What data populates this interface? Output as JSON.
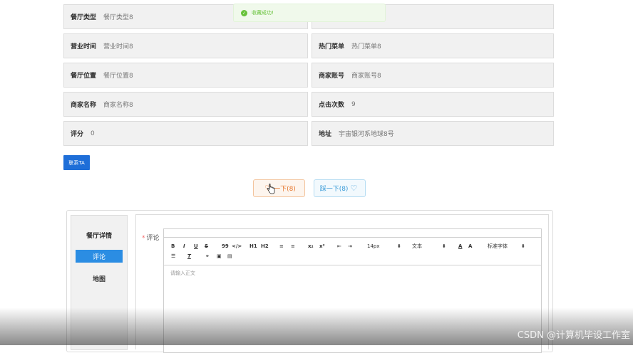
{
  "fields": [
    {
      "label": "餐厅类型",
      "value": "餐厅类型8"
    },
    {
      "label": "",
      "value": ""
    },
    {
      "label": "营业时间",
      "value": "营业时间8"
    },
    {
      "label": "热门菜单",
      "value": "热门菜单8"
    },
    {
      "label": "餐厅位置",
      "value": "餐厅位置8"
    },
    {
      "label": "商家账号",
      "value": "商家账号8"
    },
    {
      "label": "商家名称",
      "value": "商家名称8"
    },
    {
      "label": "点击次数",
      "value": "9"
    },
    {
      "label": "评分",
      "value": "0"
    },
    {
      "label": "地址",
      "value": "宇宙银河系地球8号"
    }
  ],
  "toast": {
    "message": "收藏成功!",
    "icon": "check-circle-icon",
    "color": "#67c23a"
  },
  "contact_button": "联系TA",
  "actions": {
    "favorite_label": "一下(8)",
    "dislike_label": "踩一下(8)"
  },
  "sidebar": {
    "items": [
      {
        "label": "餐厅详情",
        "active": false
      },
      {
        "label": "评论",
        "active": true
      },
      {
        "label": "地图",
        "active": false
      }
    ]
  },
  "comment_form": {
    "required_mark": "*",
    "label": "评论",
    "toolbar_row1": [
      "B",
      "I",
      "U",
      "S",
      "99",
      "</>",
      "H1",
      "H2",
      "≡",
      "≡",
      "x₂",
      "x²",
      "⇤",
      "⇥",
      "14px",
      "文本",
      "A",
      "A",
      "标准字体"
    ],
    "font_size": "14px",
    "text_style": "文本",
    "font_family": "标准字体",
    "placeholder": "请输入正文"
  },
  "watermark": "CSDN @计算机毕设工作室",
  "colors": {
    "primary_button": "#1e6ed8",
    "active_tab": "#2b8de3",
    "favorite": "#e6762c",
    "dislike": "#3a9bd8",
    "cell_bg": "#f1f1f1"
  }
}
